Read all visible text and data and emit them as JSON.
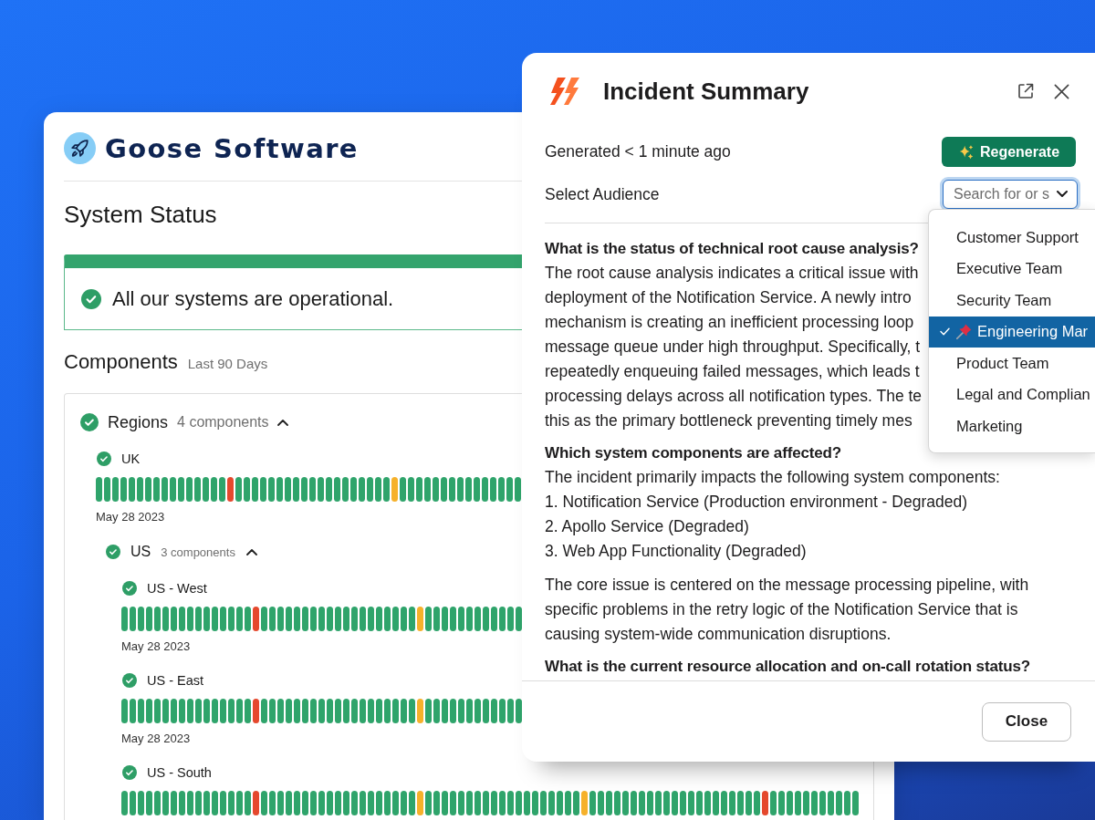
{
  "brand": {
    "name": "Goose Software"
  },
  "page": {
    "title": "System Status"
  },
  "status_banner": {
    "message": "All our systems are operational."
  },
  "components": {
    "title": "Components",
    "range": "Last 90 Days",
    "groups": [
      {
        "kind": "group",
        "name": "Regions",
        "count": "4 components",
        "expanded": true,
        "children": [
          {
            "kind": "component",
            "name": "UK",
            "date": "May 28 2023",
            "days": [
              {
                "color": "#2fa46b"
              },
              {
                "color": "#2fa46b"
              },
              {
                "color": "#2fa46b"
              },
              {
                "color": "#2fa46b"
              },
              {
                "color": "#2fa46b"
              },
              {
                "color": "#2fa46b"
              },
              {
                "color": "#2fa46b"
              },
              {
                "color": "#2fa46b"
              },
              {
                "color": "#2fa46b"
              },
              {
                "color": "#2fa46b"
              },
              {
                "color": "#2fa46b"
              },
              {
                "color": "#2fa46b"
              },
              {
                "color": "#2fa46b"
              },
              {
                "color": "#2fa46b"
              },
              {
                "color": "#2fa46b"
              },
              {
                "color": "#2fa46b"
              },
              {
                "color": "#e5482d"
              },
              {
                "color": "#2fa46b"
              },
              {
                "color": "#2fa46b"
              },
              {
                "color": "#2fa46b"
              },
              {
                "color": "#2fa46b"
              },
              {
                "color": "#2fa46b"
              },
              {
                "color": "#2fa46b"
              },
              {
                "color": "#2fa46b"
              },
              {
                "color": "#2fa46b"
              },
              {
                "color": "#2fa46b"
              },
              {
                "color": "#2fa46b"
              },
              {
                "color": "#2fa46b"
              },
              {
                "color": "#2fa46b"
              },
              {
                "color": "#2fa46b"
              },
              {
                "color": "#2fa46b"
              },
              {
                "color": "#2fa46b"
              },
              {
                "color": "#2fa46b"
              },
              {
                "color": "#2fa46b"
              },
              {
                "color": "#2fa46b"
              },
              {
                "color": "#2fa46b"
              },
              {
                "color": "#f6b12b"
              },
              {
                "color": "#2fa46b"
              },
              {
                "color": "#2fa46b"
              },
              {
                "color": "#2fa46b"
              },
              {
                "color": "#2fa46b"
              },
              {
                "color": "#2fa46b"
              },
              {
                "color": "#2fa46b"
              },
              {
                "color": "#2fa46b"
              },
              {
                "color": "#2fa46b"
              },
              {
                "color": "#2fa46b"
              },
              {
                "color": "#2fa46b"
              },
              {
                "color": "#2fa46b"
              },
              {
                "color": "#2fa46b"
              },
              {
                "color": "#2fa46b"
              },
              {
                "color": "#2fa46b"
              },
              {
                "color": "#2fa46b"
              }
            ]
          },
          {
            "kind": "group",
            "name": "US",
            "count": "3 components",
            "expanded": true,
            "children": [
              {
                "kind": "component",
                "name": "US - West",
                "date": "May 28 2023",
                "days": [
                  {
                    "color": "#2fa46b"
                  },
                  {
                    "color": "#2fa46b"
                  },
                  {
                    "color": "#2fa46b"
                  },
                  {
                    "color": "#2fa46b"
                  },
                  {
                    "color": "#2fa46b"
                  },
                  {
                    "color": "#2fa46b"
                  },
                  {
                    "color": "#2fa46b"
                  },
                  {
                    "color": "#2fa46b"
                  },
                  {
                    "color": "#2fa46b"
                  },
                  {
                    "color": "#2fa46b"
                  },
                  {
                    "color": "#2fa46b"
                  },
                  {
                    "color": "#2fa46b"
                  },
                  {
                    "color": "#2fa46b"
                  },
                  {
                    "color": "#2fa46b"
                  },
                  {
                    "color": "#2fa46b"
                  },
                  {
                    "color": "#2fa46b"
                  },
                  {
                    "color": "#e5482d"
                  },
                  {
                    "color": "#2fa46b"
                  },
                  {
                    "color": "#2fa46b"
                  },
                  {
                    "color": "#2fa46b"
                  },
                  {
                    "color": "#2fa46b"
                  },
                  {
                    "color": "#2fa46b"
                  },
                  {
                    "color": "#2fa46b"
                  },
                  {
                    "color": "#2fa46b"
                  },
                  {
                    "color": "#2fa46b"
                  },
                  {
                    "color": "#2fa46b"
                  },
                  {
                    "color": "#2fa46b"
                  },
                  {
                    "color": "#2fa46b"
                  },
                  {
                    "color": "#2fa46b"
                  },
                  {
                    "color": "#2fa46b"
                  },
                  {
                    "color": "#2fa46b"
                  },
                  {
                    "color": "#2fa46b"
                  },
                  {
                    "color": "#2fa46b"
                  },
                  {
                    "color": "#2fa46b"
                  },
                  {
                    "color": "#2fa46b"
                  },
                  {
                    "color": "#2fa46b"
                  },
                  {
                    "color": "#f6b12b"
                  },
                  {
                    "color": "#2fa46b"
                  },
                  {
                    "color": "#2fa46b"
                  },
                  {
                    "color": "#2fa46b"
                  },
                  {
                    "color": "#2fa46b"
                  },
                  {
                    "color": "#2fa46b"
                  },
                  {
                    "color": "#2fa46b"
                  },
                  {
                    "color": "#2fa46b"
                  },
                  {
                    "color": "#2fa46b"
                  },
                  {
                    "color": "#2fa46b"
                  },
                  {
                    "color": "#2fa46b"
                  },
                  {
                    "color": "#2fa46b"
                  },
                  {
                    "color": "#2fa46b"
                  }
                ]
              },
              {
                "kind": "component",
                "name": "US - East",
                "date": "May 28 2023",
                "days": [
                  {
                    "color": "#2fa46b"
                  },
                  {
                    "color": "#2fa46b"
                  },
                  {
                    "color": "#2fa46b"
                  },
                  {
                    "color": "#2fa46b"
                  },
                  {
                    "color": "#2fa46b"
                  },
                  {
                    "color": "#2fa46b"
                  },
                  {
                    "color": "#2fa46b"
                  },
                  {
                    "color": "#2fa46b"
                  },
                  {
                    "color": "#2fa46b"
                  },
                  {
                    "color": "#2fa46b"
                  },
                  {
                    "color": "#2fa46b"
                  },
                  {
                    "color": "#2fa46b"
                  },
                  {
                    "color": "#2fa46b"
                  },
                  {
                    "color": "#2fa46b"
                  },
                  {
                    "color": "#2fa46b"
                  },
                  {
                    "color": "#2fa46b"
                  },
                  {
                    "color": "#e5482d"
                  },
                  {
                    "color": "#2fa46b"
                  },
                  {
                    "color": "#2fa46b"
                  },
                  {
                    "color": "#2fa46b"
                  },
                  {
                    "color": "#2fa46b"
                  },
                  {
                    "color": "#2fa46b"
                  },
                  {
                    "color": "#2fa46b"
                  },
                  {
                    "color": "#2fa46b"
                  },
                  {
                    "color": "#2fa46b"
                  },
                  {
                    "color": "#2fa46b"
                  },
                  {
                    "color": "#2fa46b"
                  },
                  {
                    "color": "#2fa46b"
                  },
                  {
                    "color": "#2fa46b"
                  },
                  {
                    "color": "#2fa46b"
                  },
                  {
                    "color": "#2fa46b"
                  },
                  {
                    "color": "#2fa46b"
                  },
                  {
                    "color": "#2fa46b"
                  },
                  {
                    "color": "#2fa46b"
                  },
                  {
                    "color": "#2fa46b"
                  },
                  {
                    "color": "#2fa46b"
                  },
                  {
                    "color": "#f6b12b"
                  },
                  {
                    "color": "#2fa46b"
                  },
                  {
                    "color": "#2fa46b"
                  },
                  {
                    "color": "#2fa46b"
                  },
                  {
                    "color": "#2fa46b"
                  },
                  {
                    "color": "#2fa46b"
                  },
                  {
                    "color": "#2fa46b"
                  },
                  {
                    "color": "#2fa46b"
                  },
                  {
                    "color": "#2fa46b"
                  },
                  {
                    "color": "#2fa46b"
                  },
                  {
                    "color": "#2fa46b"
                  },
                  {
                    "color": "#2fa46b"
                  },
                  {
                    "color": "#2fa46b"
                  }
                ]
              },
              {
                "kind": "component",
                "name": "US - South",
                "days": [
                  {
                    "color": "#2fa46b"
                  },
                  {
                    "color": "#2fa46b"
                  },
                  {
                    "color": "#2fa46b"
                  },
                  {
                    "color": "#2fa46b"
                  },
                  {
                    "color": "#2fa46b"
                  },
                  {
                    "color": "#2fa46b"
                  },
                  {
                    "color": "#2fa46b"
                  },
                  {
                    "color": "#2fa46b"
                  },
                  {
                    "color": "#2fa46b"
                  },
                  {
                    "color": "#2fa46b"
                  },
                  {
                    "color": "#2fa46b"
                  },
                  {
                    "color": "#2fa46b"
                  },
                  {
                    "color": "#2fa46b"
                  },
                  {
                    "color": "#2fa46b"
                  },
                  {
                    "color": "#2fa46b"
                  },
                  {
                    "color": "#2fa46b"
                  },
                  {
                    "color": "#e5482d"
                  },
                  {
                    "color": "#2fa46b"
                  },
                  {
                    "color": "#2fa46b"
                  },
                  {
                    "color": "#2fa46b"
                  },
                  {
                    "color": "#2fa46b"
                  },
                  {
                    "color": "#2fa46b"
                  },
                  {
                    "color": "#2fa46b"
                  },
                  {
                    "color": "#2fa46b"
                  },
                  {
                    "color": "#2fa46b"
                  },
                  {
                    "color": "#2fa46b"
                  },
                  {
                    "color": "#2fa46b"
                  },
                  {
                    "color": "#2fa46b"
                  },
                  {
                    "color": "#2fa46b"
                  },
                  {
                    "color": "#2fa46b"
                  },
                  {
                    "color": "#2fa46b"
                  },
                  {
                    "color": "#2fa46b"
                  },
                  {
                    "color": "#2fa46b"
                  },
                  {
                    "color": "#2fa46b"
                  },
                  {
                    "color": "#2fa46b"
                  },
                  {
                    "color": "#2fa46b"
                  },
                  {
                    "color": "#f6b12b"
                  },
                  {
                    "color": "#2fa46b"
                  },
                  {
                    "color": "#2fa46b"
                  },
                  {
                    "color": "#2fa46b"
                  },
                  {
                    "color": "#2fa46b"
                  },
                  {
                    "color": "#2fa46b"
                  },
                  {
                    "color": "#2fa46b"
                  },
                  {
                    "color": "#2fa46b"
                  },
                  {
                    "color": "#2fa46b"
                  },
                  {
                    "color": "#2fa46b"
                  },
                  {
                    "color": "#2fa46b"
                  },
                  {
                    "color": "#2fa46b"
                  },
                  {
                    "color": "#2fa46b"
                  },
                  {
                    "color": "#2fa46b"
                  },
                  {
                    "color": "#2fa46b"
                  },
                  {
                    "color": "#2fa46b"
                  },
                  {
                    "color": "#2fa46b"
                  },
                  {
                    "color": "#2fa46b"
                  },
                  {
                    "color": "#2fa46b"
                  },
                  {
                    "color": "#2fa46b"
                  },
                  {
                    "color": "#f6b12b"
                  },
                  {
                    "color": "#2fa46b"
                  },
                  {
                    "color": "#2fa46b"
                  },
                  {
                    "color": "#2fa46b"
                  },
                  {
                    "color": "#2fa46b"
                  },
                  {
                    "color": "#2fa46b"
                  },
                  {
                    "color": "#2fa46b"
                  },
                  {
                    "color": "#2fa46b"
                  },
                  {
                    "color": "#2fa46b"
                  },
                  {
                    "color": "#2fa46b"
                  },
                  {
                    "color": "#2fa46b"
                  },
                  {
                    "color": "#2fa46b"
                  },
                  {
                    "color": "#2fa46b"
                  },
                  {
                    "color": "#2fa46b"
                  },
                  {
                    "color": "#2fa46b"
                  },
                  {
                    "color": "#2fa46b"
                  },
                  {
                    "color": "#2fa46b"
                  },
                  {
                    "color": "#2fa46b"
                  },
                  {
                    "color": "#2fa46b"
                  },
                  {
                    "color": "#2fa46b"
                  },
                  {
                    "color": "#2fa46b"
                  },
                  {
                    "color": "#2fa46b"
                  },
                  {
                    "color": "#e5482d"
                  },
                  {
                    "color": "#2fa46b"
                  },
                  {
                    "color": "#2fa46b"
                  },
                  {
                    "color": "#2fa46b"
                  },
                  {
                    "color": "#2fa46b"
                  },
                  {
                    "color": "#2fa46b"
                  },
                  {
                    "color": "#2fa46b"
                  },
                  {
                    "color": "#2fa46b"
                  },
                  {
                    "color": "#2fa46b"
                  },
                  {
                    "color": "#2fa46b"
                  },
                  {
                    "color": "#2fa46b"
                  },
                  {
                    "color": "#2fa46b"
                  }
                ]
              }
            ]
          }
        ]
      }
    ]
  },
  "incident_modal": {
    "title": "Incident Summary",
    "generated": "Generated < 1 minute ago",
    "regenerate_button": "Regenerate",
    "audience": {
      "label": "Select Audience",
      "placeholder": "Search for or s",
      "expanded": true,
      "options": [
        {
          "label": "Customer Support",
          "selected": false,
          "pinned": false
        },
        {
          "label": "Executive Team",
          "selected": false,
          "pinned": false
        },
        {
          "label": "Security Team",
          "selected": false,
          "pinned": false
        },
        {
          "label": "Engineering Mar",
          "selected": true,
          "pinned": true
        },
        {
          "label": "Product Team",
          "selected": false,
          "pinned": false
        },
        {
          "label": "Legal and Complian",
          "selected": false,
          "pinned": false
        },
        {
          "label": "Marketing",
          "selected": false,
          "pinned": false
        }
      ]
    },
    "summary": [
      {
        "kind": "heading",
        "text": "What is the status of technical root cause analysis?"
      },
      {
        "kind": "lines",
        "lines": [
          "The root cause analysis indicates a critical issue with",
          "deployment of the Notification Service. A newly intro",
          "mechanism is creating an inefficient processing loop",
          "message queue under high throughput. Specifically, t",
          "repeatedly enqueuing failed messages, which leads t",
          "processing delays across all notification types. The te",
          "this as the primary bottleneck preventing timely mes"
        ]
      },
      {
        "kind": "heading",
        "text": "Which system components are affected?"
      },
      {
        "kind": "lines",
        "lines": [
          "The incident primarily impacts the following system components:",
          "1. Notification Service (Production environment - Degraded)",
          "2. Apollo Service (Degraded)",
          "3. Web App Functionality (Degraded)"
        ]
      },
      {
        "kind": "paragraph",
        "text": "The core issue is centered on the message processing pipeline, with specific problems in the retry logic of the Notification Service that is causing system-wide communication disruptions."
      },
      {
        "kind": "heading",
        "text": "What is the current resource allocation and on-call rotation status?"
      }
    ],
    "close_button": "Close"
  }
}
